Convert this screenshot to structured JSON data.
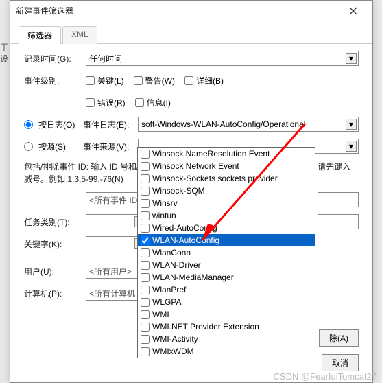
{
  "window": {
    "title": "新建事件筛选器"
  },
  "tabs": {
    "filter": "筛选器",
    "xml": "XML"
  },
  "labels": {
    "logged": "记录时间(G):",
    "level": "事件级别:",
    "bylog": "按日志(O)",
    "bysource": "按源(S)",
    "eventlogs": "事件日志(E):",
    "eventsources": "事件来源(V):",
    "idhint": "包括/排除事件 ID: 输入 ID 号和/",
    "idhint2": "减号。例如 1,3,5-99,-76(N)",
    "task": "任务类别(T):",
    "keywords": "关键字(K):",
    "user": "用户(U):",
    "computer": "计算机(P):",
    "righthint": "请先键入"
  },
  "values": {
    "anytime": "任何时间",
    "eventlog": "soft-Windows-WLAN-AutoConfig/Operational",
    "allids": "<所有事件 ID",
    "allusers": "<所有用户>",
    "allcomputers": "<所有计算机"
  },
  "checkboxes": {
    "critical": "关键(L)",
    "warning": "警告(W)",
    "verbose": "详细(B)",
    "error": "错误(R)",
    "info": "信息(I)"
  },
  "dropdown": [
    {
      "label": "Winsock NameResolution Event",
      "checked": false
    },
    {
      "label": "Winsock Network Event",
      "checked": false
    },
    {
      "label": "Winsock-Sockets sockets provider",
      "checked": false
    },
    {
      "label": "Winsock-SQM",
      "checked": false
    },
    {
      "label": "Winsrv",
      "checked": false
    },
    {
      "label": "wintun",
      "checked": false
    },
    {
      "label": "Wired-AutoConfig",
      "checked": false
    },
    {
      "label": "WLAN-AutoConfig",
      "checked": true,
      "selected": true
    },
    {
      "label": "WlanConn",
      "checked": false
    },
    {
      "label": "WLAN-Driver",
      "checked": false
    },
    {
      "label": "WLAN-MediaManager",
      "checked": false
    },
    {
      "label": "WlanPref",
      "checked": false
    },
    {
      "label": "WLGPA",
      "checked": false
    },
    {
      "label": "WMI",
      "checked": false
    },
    {
      "label": "WMI.NET Provider Extension",
      "checked": false
    },
    {
      "label": "WMI-Activity",
      "checked": false
    },
    {
      "label": "WMIxWDM",
      "checked": false
    }
  ],
  "buttons": {
    "clear": "除(A)",
    "cancel": "取消"
  },
  "watermark": "CSDN @FearfulTomcat27"
}
